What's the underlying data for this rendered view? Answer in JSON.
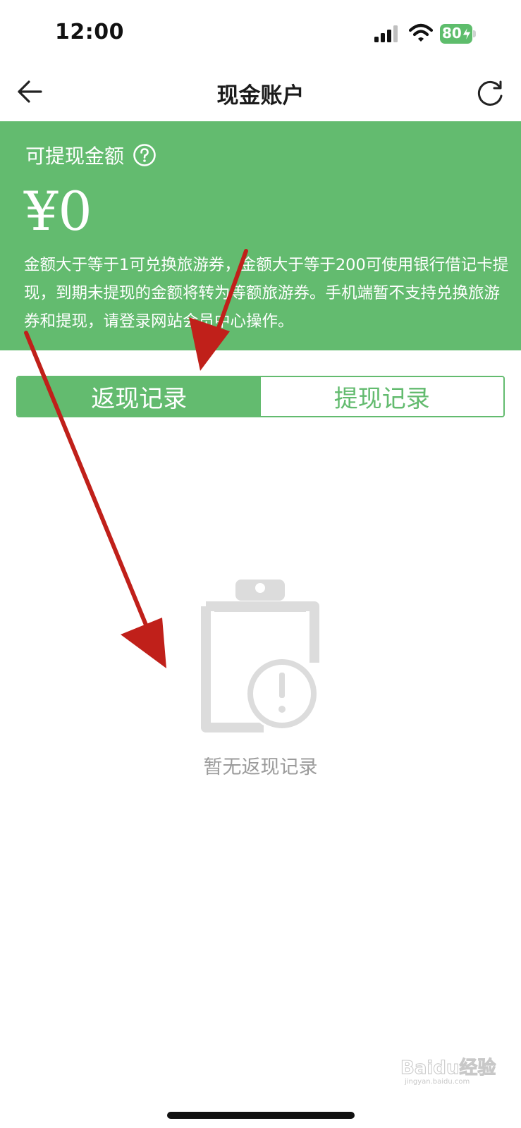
{
  "status_bar": {
    "time": "12:00",
    "battery": "80",
    "icons": [
      "signal-icon",
      "wifi-icon",
      "battery-charging-icon"
    ]
  },
  "nav": {
    "title": "现金账户",
    "back_icon": "arrow-left-icon",
    "refresh_icon": "refresh-icon"
  },
  "balance": {
    "label": "可提现金额",
    "help_icon": "question-circle-icon",
    "amount": "¥0",
    "note": "金额大于等于1可兑换旅游券，金额大于等于200可使用银行借记卡提现，到期未提现的金额将转为等额旅游券。手机端暂不支持兑换旅游券和提现，请登录网站会员中心操作。"
  },
  "tabs": [
    {
      "label": "返现记录",
      "active": true
    },
    {
      "label": "提现记录",
      "active": false
    }
  ],
  "empty_state": {
    "icon": "clipboard-alert-icon",
    "text": "暂无返现记录"
  },
  "watermark": {
    "text": "Baidu经验",
    "subtext": "jingyan.baidu.com"
  },
  "colors": {
    "brand_green": "#63bb6f",
    "annotation_red": "#c0201a",
    "empty_gray": "#dcdcdc"
  }
}
